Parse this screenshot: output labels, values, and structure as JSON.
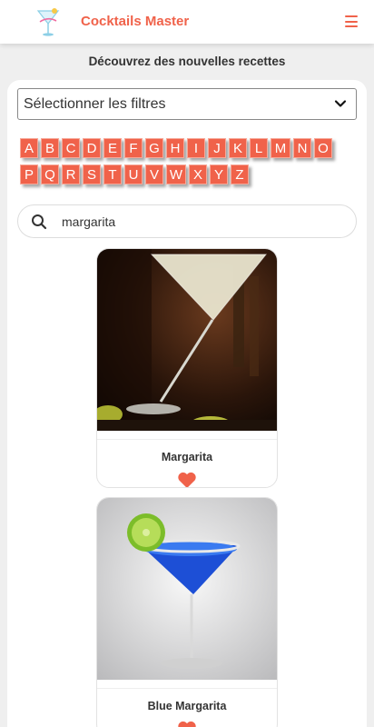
{
  "header": {
    "title": "Cocktails Master",
    "logo_icon": "cocktail-logo",
    "menu_icon": "hamburger-icon"
  },
  "tagline": "Découvrez des nouvelles recettes",
  "filters": {
    "select_label": "Sélectionner les filtres",
    "letters_row1": [
      "A",
      "B",
      "C",
      "D",
      "E",
      "F",
      "G",
      "H",
      "I",
      "J",
      "K",
      "L",
      "M",
      "N",
      "O"
    ],
    "letters_row2": [
      "P",
      "Q",
      "R",
      "S",
      "T",
      "U",
      "V",
      "W",
      "X",
      "Y",
      "Z"
    ]
  },
  "search": {
    "value": "margarita",
    "icon": "search-icon"
  },
  "results": [
    {
      "name": "Margarita",
      "favorite_icon": "heart-icon"
    },
    {
      "name": "Blue Margarita",
      "favorite_icon": "heart-icon"
    }
  ],
  "colors": {
    "accent": "#f0624a",
    "background": "#efefef"
  }
}
